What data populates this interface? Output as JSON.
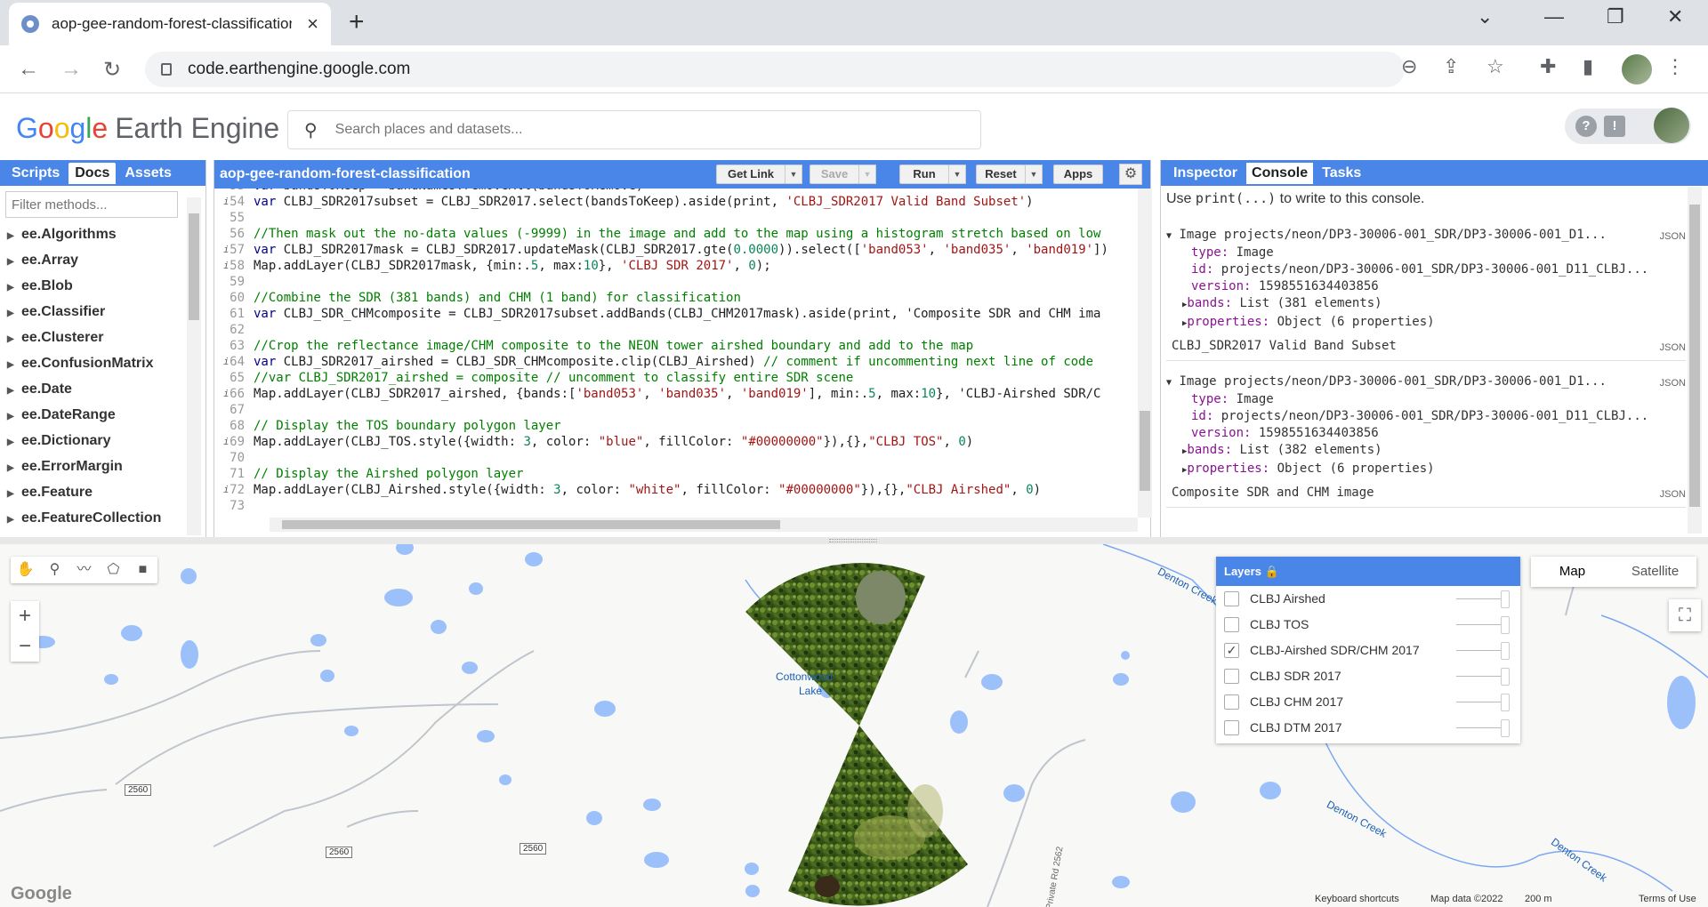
{
  "browser": {
    "tab_title": "aop-gee-random-forest-classification",
    "url": "code.earthengine.google.com"
  },
  "header": {
    "search_placeholder": "Search places and datasets..."
  },
  "left_panel": {
    "tabs": [
      "Scripts",
      "Docs",
      "Assets"
    ],
    "active_tab": "Docs",
    "filter_placeholder": "Filter methods...",
    "items": [
      "ee.Algorithms",
      "ee.Array",
      "ee.Blob",
      "ee.Classifier",
      "ee.Clusterer",
      "ee.ConfusionMatrix",
      "ee.Date",
      "ee.DateRange",
      "ee.Dictionary",
      "ee.ErrorMargin",
      "ee.Feature",
      "ee.FeatureCollection",
      "ee.Filter"
    ]
  },
  "editor": {
    "script_name": "aop-gee-random-forest-classification",
    "buttons": {
      "get_link": "Get Link",
      "save": "Save",
      "run": "Run",
      "reset": "Reset",
      "apps": "Apps"
    },
    "lines": [
      {
        "n": "53",
        "text": "var bandsToKeep = bandNames.removeAll(bandsToRemove)",
        "info": false
      },
      {
        "n": "54",
        "text": "var CLBJ_SDR2017subset = CLBJ_SDR2017.select(bandsToKeep).aside(print, 'CLBJ_SDR2017 Valid Band Subset')",
        "info": true
      },
      {
        "n": "55",
        "text": "",
        "info": false
      },
      {
        "n": "56",
        "text": "//Then mask out the no-data values (-9999) in the image and add to the map using a histogram stretch based on low",
        "info": false,
        "comment": true
      },
      {
        "n": "57",
        "text": "var CLBJ_SDR2017mask = CLBJ_SDR2017.updateMask(CLBJ_SDR2017.gte(0.0000)).select(['band053', 'band035', 'band019'])",
        "info": true
      },
      {
        "n": "58",
        "text": "Map.addLayer(CLBJ_SDR2017mask, {min:.5, max:10}, 'CLBJ SDR 2017', 0);",
        "info": true
      },
      {
        "n": "59",
        "text": "",
        "info": false
      },
      {
        "n": "60",
        "text": "//Combine the SDR (381 bands) and CHM (1 band) for classification",
        "info": false,
        "comment": true
      },
      {
        "n": "61",
        "text": "var CLBJ_SDR_CHMcomposite = CLBJ_SDR2017subset.addBands(CLBJ_CHM2017mask).aside(print, 'Composite SDR and CHM ima",
        "info": false
      },
      {
        "n": "62",
        "text": "",
        "info": false
      },
      {
        "n": "63",
        "text": "//Crop the reflectance image/CHM composite to the NEON tower airshed boundary and add to the map",
        "info": false,
        "comment": true
      },
      {
        "n": "64",
        "text": "var CLBJ_SDR2017_airshed = CLBJ_SDR_CHMcomposite.clip(CLBJ_Airshed) // comment if uncommenting next line of code",
        "info": true
      },
      {
        "n": "65",
        "text": "//var CLBJ_SDR2017_airshed = composite // uncomment to classify entire SDR scene",
        "info": false,
        "comment": true
      },
      {
        "n": "66",
        "text": "Map.addLayer(CLBJ_SDR2017_airshed, {bands:['band053', 'band035', 'band019'], min:.5, max:10}, 'CLBJ-Airshed SDR/C",
        "info": true
      },
      {
        "n": "67",
        "text": "",
        "info": false
      },
      {
        "n": "68",
        "text": "// Display the TOS boundary polygon layer",
        "info": false,
        "comment": true
      },
      {
        "n": "69",
        "text": "Map.addLayer(CLBJ_TOS.style({width: 3, color: \"blue\", fillColor: \"#00000000\"}),{},\"CLBJ TOS\", 0)",
        "info": true
      },
      {
        "n": "70",
        "text": "",
        "info": false
      },
      {
        "n": "71",
        "text": "// Display the Airshed polygon layer",
        "info": false,
        "comment": true
      },
      {
        "n": "72",
        "text": "Map.addLayer(CLBJ_Airshed.style({width: 3, color: \"white\", fillColor: \"#00000000\"}),{},\"CLBJ Airshed\", 0)",
        "info": true
      },
      {
        "n": "73",
        "text": "",
        "info": false
      }
    ]
  },
  "right_panel": {
    "tabs": [
      "Inspector",
      "Console",
      "Tasks"
    ],
    "active_tab": "Console",
    "hint_prefix": "Use ",
    "hint_code": "print(...)",
    "hint_suffix": " to write to this console.",
    "json_label": "JSON",
    "entries": [
      {
        "header": "Image projects/neon/DP3-30006-001_SDR/DP3-30006-001_D1...",
        "type": "Image",
        "id": "projects/neon/DP3-30006-001_SDR/DP3-30006-001_D11_CLBJ...",
        "version": "1598551634403856",
        "bands": "List (381 elements)",
        "properties": "Object (6 properties)",
        "label": "CLBJ_SDR2017 Valid Band Subset"
      },
      {
        "header": "Image projects/neon/DP3-30006-001_SDR/DP3-30006-001_D1...",
        "type": "Image",
        "id": "projects/neon/DP3-30006-001_SDR/DP3-30006-001_D11_CLBJ...",
        "version": "1598551634403856",
        "bands": "List (382 elements)",
        "properties": "Object (6 properties)",
        "label": "Composite SDR and CHM image"
      }
    ]
  },
  "map": {
    "layers_title": "Layers",
    "layers": [
      {
        "name": "CLBJ Airshed",
        "checked": false
      },
      {
        "name": "CLBJ TOS",
        "checked": false
      },
      {
        "name": "CLBJ-Airshed SDR/CHM 2017",
        "checked": true
      },
      {
        "name": "CLBJ SDR 2017",
        "checked": false
      },
      {
        "name": "CLBJ CHM 2017",
        "checked": false
      },
      {
        "name": "CLBJ DTM 2017",
        "checked": false
      }
    ],
    "map_type": {
      "map": "Map",
      "satellite": "Satellite"
    },
    "labels": {
      "cottonwood": "Cottonwood",
      "lake": "Lake",
      "denton_creek": "Denton Creek",
      "private_rd": "Private Rd 2562",
      "route": "2560"
    },
    "attribution": {
      "shortcuts": "Keyboard shortcuts",
      "data": "Map data ©2022",
      "scale": "200 m",
      "terms": "Terms of Use"
    },
    "google": "Google"
  }
}
